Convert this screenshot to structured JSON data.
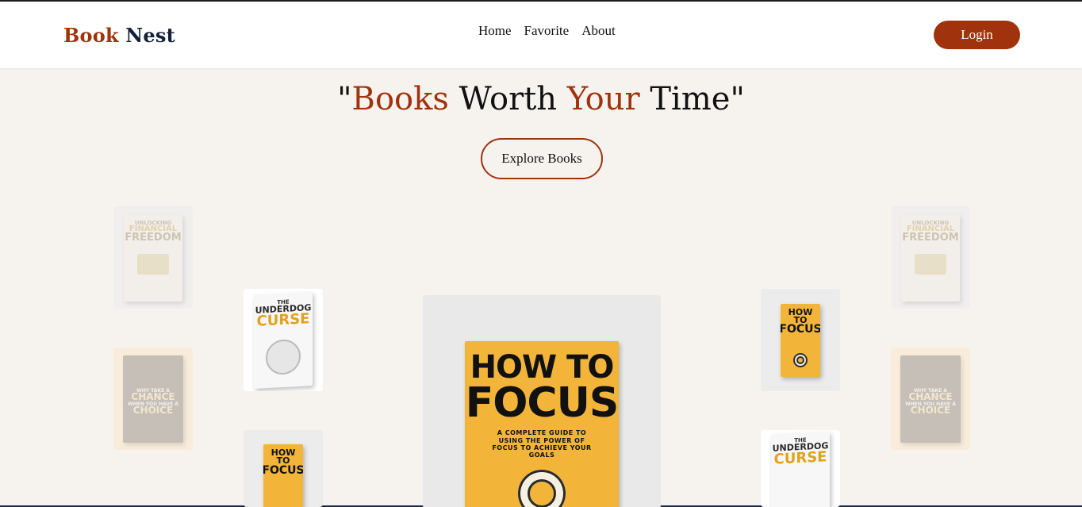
{
  "nav": {
    "brand_part1": "Book",
    "brand_part2": "Nest",
    "links": [
      "Home",
      "Favorite",
      "About"
    ],
    "login_label": "Login"
  },
  "hero": {
    "quote_open": "\"",
    "word1": "Books",
    "word2": " Worth ",
    "word3": "Your",
    "word4": " Time",
    "quote_close": "\"",
    "explore_label": "Explore Books"
  },
  "books": {
    "focus": {
      "title1": "HOW TO",
      "title2": "FOCUS",
      "subtitle": "A COMPLETE GUIDE TO USING THE POWER OF FOCUS TO ACHIEVE YOUR GOALS"
    },
    "underdog": {
      "title1": "THE",
      "title2": "UNDERDOG",
      "title3": "CURSE"
    },
    "freedom": {
      "title1": "UNLOCKING",
      "title2": "FINANCIAL",
      "title3": "FREEDOM"
    },
    "choice": {
      "title1": "WHY TAKE A",
      "title2": "CHANCE",
      "title3": "WHEN YOU HAVE A",
      "title4": "CHOICE"
    }
  },
  "colors": {
    "accent": "#a0330d",
    "navy": "#14203a",
    "background": "#f6f3ef"
  }
}
